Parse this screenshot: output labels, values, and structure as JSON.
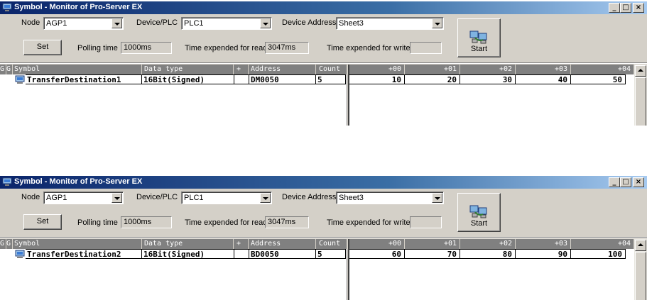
{
  "windows": [
    {
      "title": "Symbol - Monitor of Pro-Server EX",
      "node_label": "Node",
      "node_value": "AGP1",
      "device_label": "Device/PLC",
      "device_value": "PLC1",
      "address_label": "Device Address",
      "address_value": "Sheet3",
      "set_label": "Set",
      "polling_label": "Polling time",
      "polling_value": "1000ms",
      "read_label": "Time expended for read",
      "read_value": "3047ms",
      "write_label": "Time expended for write",
      "write_value": "",
      "start_label": "Start",
      "headers": {
        "g1": "G",
        "g2": "G",
        "symbol": "Symbol",
        "datatype": "Data type",
        "plus": "+",
        "address": "Address",
        "count": "Count"
      },
      "value_headers": [
        "+00",
        "+01",
        "+02",
        "+03",
        "+04"
      ],
      "row": {
        "symbol": "TransferDestination1",
        "datatype": "16Bit(Signed)",
        "plus": "",
        "address": "DM0050",
        "count": "5"
      },
      "values": [
        "10",
        "20",
        "30",
        "40",
        "50"
      ]
    },
    {
      "title": "Symbol - Monitor of Pro-Server EX",
      "node_label": "Node",
      "node_value": "AGP1",
      "device_label": "Device/PLC",
      "device_value": "PLC1",
      "address_label": "Device Address",
      "address_value": "Sheet3",
      "set_label": "Set",
      "polling_label": "Polling time",
      "polling_value": "1000ms",
      "read_label": "Time expended for read",
      "read_value": "3047ms",
      "write_label": "Time expended for write",
      "write_value": "",
      "start_label": "Start",
      "headers": {
        "g1": "G",
        "g2": "G",
        "symbol": "Symbol",
        "datatype": "Data type",
        "plus": "+",
        "address": "Address",
        "count": "Count"
      },
      "value_headers": [
        "+00",
        "+01",
        "+02",
        "+03",
        "+04"
      ],
      "row": {
        "symbol": "TransferDestination2",
        "datatype": "16Bit(Signed)",
        "plus": "",
        "address": "BD0050",
        "count": "5"
      },
      "values": [
        "60",
        "70",
        "80",
        "90",
        "100"
      ]
    }
  ],
  "icons": {
    "app": "monitor-app-icon",
    "start": "start-monitor-icon",
    "symbol": "symbol-monitor-icon"
  },
  "colors": {
    "titlebar_start": "#0a246a",
    "titlebar_end": "#a6caf0",
    "face": "#d4d0c8",
    "header_bg": "#808080"
  }
}
